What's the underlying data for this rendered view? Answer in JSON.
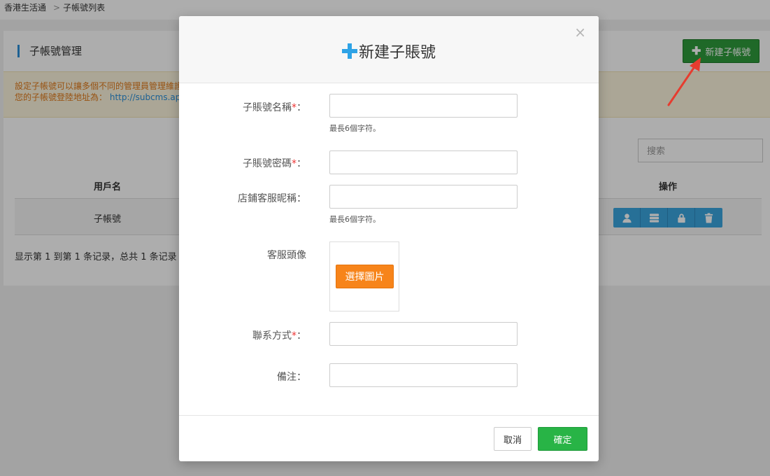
{
  "breadcrumb": {
    "home": "香港生活通",
    "current": "子帳號列表"
  },
  "page": {
    "title": "子帳號管理",
    "new_button_label": "新建子帳號",
    "notice_line1": "設定子帳號可以讓多個不同的管理員管理維護",
    "notice_line2_prefix": "您的子帳號登陸地址為：",
    "notice_link": "http://subcms.ap",
    "search_placeholder": "搜索"
  },
  "table": {
    "headers": {
      "username": "用戶名",
      "actions": "操作"
    },
    "rows": [
      {
        "username": "子帳號"
      }
    ],
    "action_icons": [
      "user-icon",
      "list-icon",
      "lock-icon",
      "trash-icon"
    ],
    "pager_info": "显示第 1 到第 1 条记录，总共 1 条记录"
  },
  "modal": {
    "title": "新建子賬號",
    "close_glyph": "×",
    "fields": {
      "name_label": "子賬號名稱",
      "name_hint": "最長6個字符。",
      "password_label": "子賬號密碼",
      "nickname_label": "店鋪客服昵稱",
      "nickname_hint": "最長6個字符。",
      "avatar_label": "客服頭像",
      "avatar_button": "選擇圖片",
      "contact_label": "聯系方式",
      "remark_label": "備注"
    },
    "required_mark": "*",
    "colon": "：",
    "cancel_label": "取消",
    "confirm_label": "確定"
  },
  "colors": {
    "primary_green": "#28b446",
    "accent_blue": "#2ea3e6",
    "orange": "#f7841a"
  }
}
